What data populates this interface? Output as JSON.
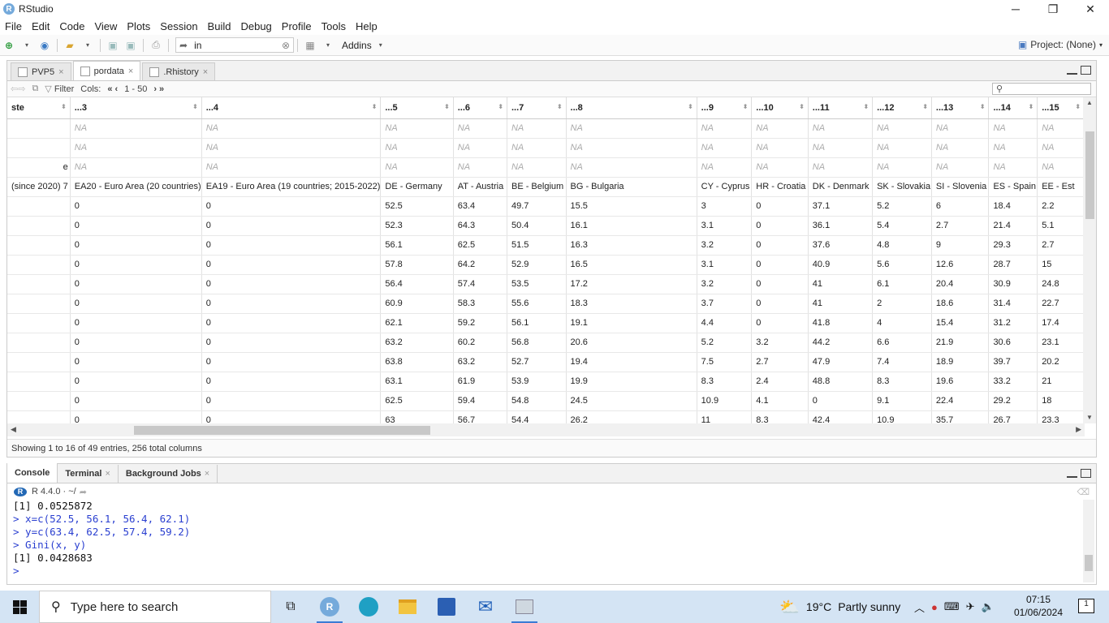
{
  "window": {
    "title": "RStudio",
    "minimize": "─",
    "restore": "❐",
    "close": "✕"
  },
  "menu": [
    "File",
    "Edit",
    "Code",
    "View",
    "Plots",
    "Session",
    "Build",
    "Debug",
    "Profile",
    "Tools",
    "Help"
  ],
  "toolbar": {
    "goto_value": "in",
    "addins_label": "Addins",
    "project_label": "Project: (None)"
  },
  "editor_tabs": [
    {
      "label": "PVP5",
      "close": "×"
    },
    {
      "label": "pordata",
      "close": "×"
    },
    {
      "label": ".Rhistory",
      "close": "×"
    }
  ],
  "viewer": {
    "filter_label": "Filter",
    "cols_label": "Cols:",
    "cols_range": "1 - 50",
    "status": "Showing 1 to 16 of 49 entries, 256 total columns"
  },
  "grid": {
    "headers": [
      "ste",
      "...3",
      "...4",
      "...5",
      "...6",
      "...7",
      "...8",
      "...9",
      "...10",
      "...11",
      "...12",
      "...13",
      "...14",
      "...15"
    ],
    "rows": [
      [
        "",
        "NA",
        "NA",
        "NA",
        "NA",
        "NA",
        "NA",
        "NA",
        "NA",
        "NA",
        "NA",
        "NA",
        "NA",
        "NA"
      ],
      [
        "",
        "NA",
        "NA",
        "NA",
        "NA",
        "NA",
        "NA",
        "NA",
        "NA",
        "NA",
        "NA",
        "NA",
        "NA",
        "NA"
      ],
      [
        "e",
        "NA",
        "NA",
        "NA",
        "NA",
        "NA",
        "NA",
        "NA",
        "NA",
        "NA",
        "NA",
        "NA",
        "NA",
        "NA"
      ],
      [
        "7 (since 2020)",
        "EA20 - Euro Area (20 countries)",
        "EA19 - Euro Area (19 countries; 2015-2022)",
        "DE - Germany",
        "AT - Austria",
        "BE - Belgium",
        "BG - Bulgaria",
        "CY - Cyprus",
        "HR - Croatia",
        "DK - Denmark",
        "SK - Slovakia",
        "SI - Slovenia",
        "ES - Spain",
        "EE - Est"
      ],
      [
        "",
        "0",
        "0",
        "52.5",
        "63.4",
        "49.7",
        "15.5",
        "3",
        "0",
        "37.1",
        "5.2",
        "6",
        "18.4",
        "2.2"
      ],
      [
        "",
        "0",
        "0",
        "52.3",
        "64.3",
        "50.4",
        "16.1",
        "3.1",
        "0",
        "36.1",
        "5.4",
        "2.7",
        "21.4",
        "5.1"
      ],
      [
        "",
        "0",
        "0",
        "56.1",
        "62.5",
        "51.5",
        "16.3",
        "3.2",
        "0",
        "37.6",
        "4.8",
        "9",
        "29.3",
        "2.7"
      ],
      [
        "",
        "0",
        "0",
        "57.8",
        "64.2",
        "52.9",
        "16.5",
        "3.1",
        "0",
        "40.9",
        "5.6",
        "12.6",
        "28.7",
        "15"
      ],
      [
        "",
        "0",
        "0",
        "56.4",
        "57.4",
        "53.5",
        "17.2",
        "3.2",
        "0",
        "41",
        "6.1",
        "20.4",
        "30.9",
        "24.8"
      ],
      [
        "",
        "0",
        "0",
        "60.9",
        "58.3",
        "55.6",
        "18.3",
        "3.7",
        "0",
        "41",
        "2",
        "18.6",
        "31.4",
        "22.7"
      ],
      [
        "",
        "0",
        "0",
        "62.1",
        "59.2",
        "56.1",
        "19.1",
        "4.4",
        "0",
        "41.8",
        "4",
        "15.4",
        "31.2",
        "17.4"
      ],
      [
        "",
        "0",
        "0",
        "63.2",
        "60.2",
        "56.8",
        "20.6",
        "5.2",
        "3.2",
        "44.2",
        "6.6",
        "21.9",
        "30.6",
        "23.1"
      ],
      [
        "",
        "0",
        "0",
        "63.8",
        "63.2",
        "52.7",
        "19.4",
        "7.5",
        "2.7",
        "47.9",
        "7.4",
        "18.9",
        "39.7",
        "20.2"
      ],
      [
        "",
        "0",
        "0",
        "63.1",
        "61.9",
        "53.9",
        "19.9",
        "8.3",
        "2.4",
        "48.8",
        "8.3",
        "19.6",
        "33.2",
        "21"
      ],
      [
        "",
        "0",
        "0",
        "62.5",
        "59.4",
        "54.8",
        "24.5",
        "10.9",
        "4.1",
        "0",
        "9.1",
        "22.4",
        "29.2",
        "18"
      ],
      [
        "",
        "0",
        "0",
        "63",
        "56.7",
        "54.4",
        "26.2",
        "11",
        "8.3",
        "42.4",
        "10.9",
        "35.7",
        "26.7",
        "23.3"
      ]
    ]
  },
  "console_tabs": [
    {
      "label": "Console",
      "close": ""
    },
    {
      "label": "Terminal",
      "close": "×"
    },
    {
      "label": "Background Jobs",
      "close": "×"
    }
  ],
  "console": {
    "r_version": "R 4.4.0 · ~/",
    "lines": [
      {
        "type": "out",
        "text": "[1] 0.0525872"
      },
      {
        "type": "in",
        "text": "> x=c(52.5, 56.1, 56.4, 62.1)"
      },
      {
        "type": "in",
        "text": "> y=c(63.4, 62.5, 57.4, 59.2)"
      },
      {
        "type": "in",
        "text": "> Gini(x, y)"
      },
      {
        "type": "out",
        "text": "[1] 0.0428683"
      },
      {
        "type": "in",
        "text": ">"
      }
    ]
  },
  "taskbar": {
    "search_placeholder": "Type here to search",
    "weather_temp": "19°C",
    "weather_desc": "Partly sunny",
    "time": "07:15",
    "date": "01/06/2024",
    "notifications": "1"
  },
  "colors": {
    "console_input": "#2a3fd0",
    "taskbar_bg": "#d4e4f4",
    "r_blue": "#2268b5"
  }
}
